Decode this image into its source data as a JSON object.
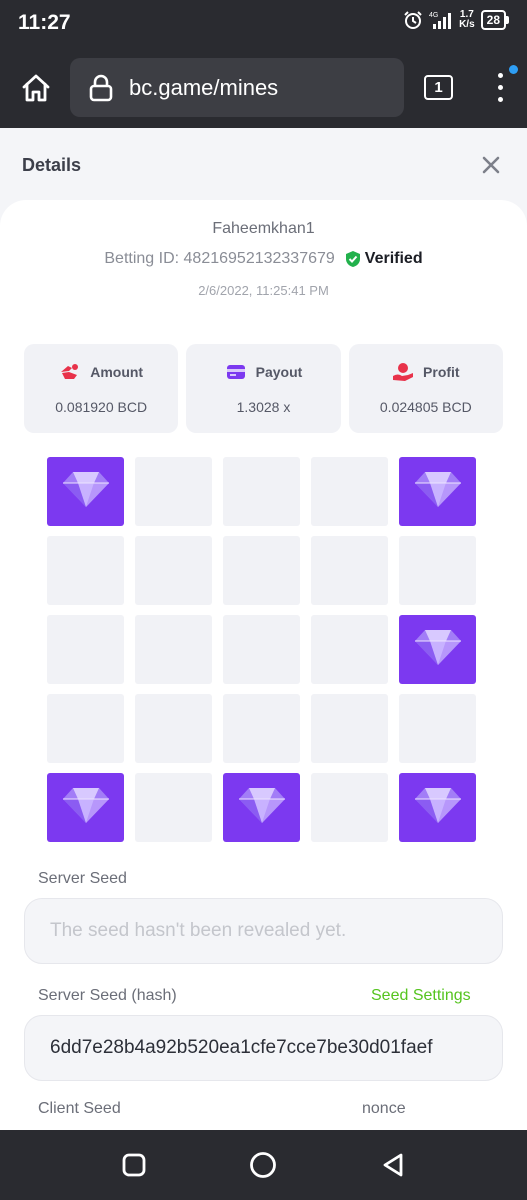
{
  "status": {
    "time": "11:27",
    "network": "4G",
    "speed_value": "1.7",
    "speed_unit": "K/s",
    "battery": "28"
  },
  "browser": {
    "url": "bc.game/mines",
    "tab_count": "1"
  },
  "details": {
    "title": "Details",
    "username": "Faheemkhan1",
    "betting_id": "Betting ID: 48216952132337679",
    "verified": "Verified",
    "timestamp": "2/6/2022, 11:25:41 PM"
  },
  "stats": [
    {
      "label": "Amount",
      "value": "0.081920 BCD",
      "icon": "amount-icon",
      "color": "#e8324a"
    },
    {
      "label": "Payout",
      "value": "1.3028 x",
      "icon": "payout-icon",
      "color": "#7c39f0"
    },
    {
      "label": "Profit",
      "value": "0.024805 BCD",
      "icon": "profit-icon",
      "color": "#e8324a"
    }
  ],
  "grid": {
    "rows": 5,
    "cols": 5,
    "gems": [
      [
        1,
        0,
        0,
        0,
        1
      ],
      [
        0,
        0,
        0,
        0,
        0
      ],
      [
        0,
        0,
        0,
        0,
        1
      ],
      [
        0,
        0,
        0,
        0,
        0
      ],
      [
        1,
        0,
        1,
        0,
        1
      ]
    ],
    "gem_color": "#7c39f0"
  },
  "seeds": {
    "server_seed_label": "Server Seed",
    "server_seed_placeholder": "The seed hasn't been revealed yet.",
    "server_hash_label": "Server Seed (hash)",
    "seed_settings_label": "Seed Settings",
    "server_hash_value": "6dd7e28b4a92b520ea1cfe7cce7be30d01faef",
    "client_seed_label": "Client Seed",
    "nonce_label": "nonce"
  },
  "colors": {
    "accent_green": "#55c41f",
    "accent_purple": "#7c39f0",
    "verified_green": "#22b14c"
  }
}
